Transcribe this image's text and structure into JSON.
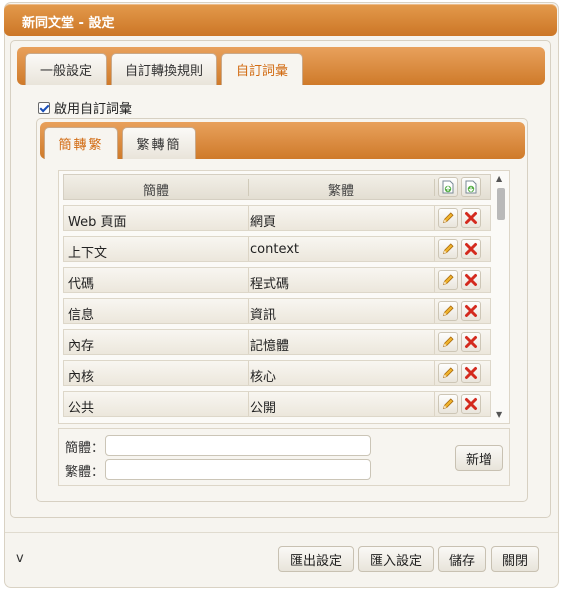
{
  "window": {
    "title": "新同文堂 - 設定"
  },
  "tabs": [
    {
      "label": "一般設定",
      "active": false
    },
    {
      "label": "自訂轉換規則",
      "active": false
    },
    {
      "label": "自訂詞彙",
      "active": true
    }
  ],
  "enable_checkbox": {
    "label": "啟用自訂詞彙",
    "checked": true
  },
  "subtabs": [
    {
      "label": "簡轉繁",
      "active": true
    },
    {
      "label": "繁轉簡",
      "active": false
    }
  ],
  "table": {
    "headers": [
      "簡體",
      "繁體"
    ],
    "rows": [
      {
        "simplified": "Web 頁面",
        "traditional": "網頁"
      },
      {
        "simplified": "上下文",
        "traditional": "context"
      },
      {
        "simplified": "代碼",
        "traditional": "程式碼"
      },
      {
        "simplified": "信息",
        "traditional": "資訊"
      },
      {
        "simplified": "內存",
        "traditional": "記憶體"
      },
      {
        "simplified": "內核",
        "traditional": "核心"
      },
      {
        "simplified": "公共",
        "traditional": "公開"
      }
    ]
  },
  "form": {
    "simplified_label": "簡體：",
    "traditional_label": "繁體：",
    "simplified_value": "",
    "traditional_value": "",
    "add_label": "新增"
  },
  "footer": {
    "version": "v",
    "export_label": "匯出設定",
    "import_label": "匯入設定",
    "save_label": "儲存",
    "close_label": "關閉"
  },
  "colors": {
    "accent": "#d9863a",
    "active_tab_text": "#d26b12",
    "delete_icon": "#d42a1e",
    "edit_icon": "#e8a020"
  }
}
